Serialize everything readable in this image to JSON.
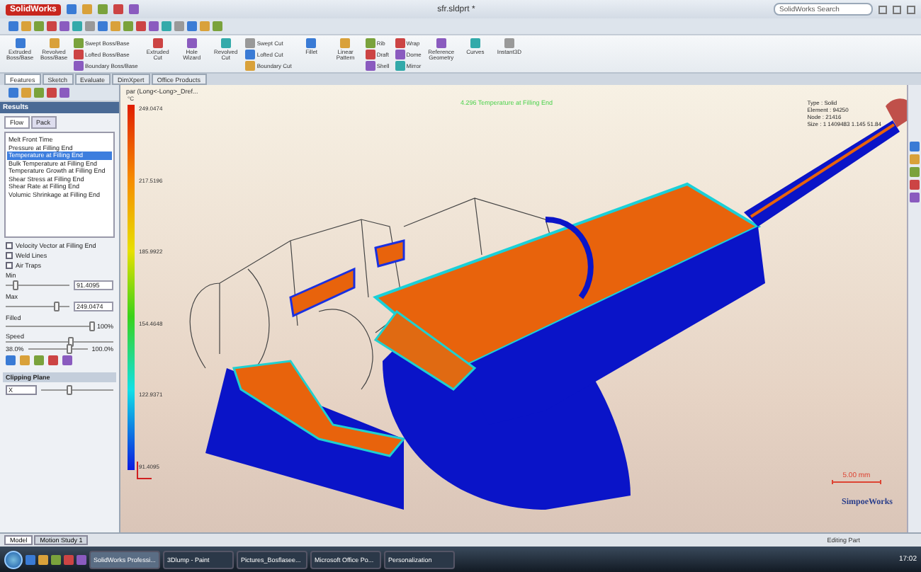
{
  "window": {
    "app": "SolidWorks",
    "title": "sfr.sldprt *",
    "search": {
      "placeholder": "SolidWorks Search"
    }
  },
  "ribbon": [
    {
      "kind": "large",
      "label": "Extruded Boss/Base"
    },
    {
      "kind": "large",
      "label": "Revolved Boss/Base"
    },
    {
      "kind": "stack",
      "items": [
        "Swept Boss/Base",
        "Lofted Boss/Base",
        "Boundary Boss/Base"
      ]
    },
    {
      "kind": "large",
      "label": "Extruded Cut"
    },
    {
      "kind": "large",
      "label": "Hole Wizard"
    },
    {
      "kind": "large",
      "label": "Revolved Cut"
    },
    {
      "kind": "stack",
      "items": [
        "Swept Cut",
        "Lofted Cut",
        "Boundary Cut"
      ]
    },
    {
      "kind": "large",
      "label": "Fillet"
    },
    {
      "kind": "large",
      "label": "Linear Pattern"
    },
    {
      "kind": "stack",
      "items": [
        "Rib",
        "Draft",
        "Shell"
      ]
    },
    {
      "kind": "stack",
      "items": [
        "Wrap",
        "Dome",
        "Mirror"
      ]
    },
    {
      "kind": "large",
      "label": "Reference Geometry"
    },
    {
      "kind": "large",
      "label": "Curves"
    },
    {
      "kind": "large",
      "label": "Instant3D"
    }
  ],
  "command_tabs": [
    {
      "label": "Features",
      "selected": true
    },
    {
      "label": "Sketch",
      "selected": false
    },
    {
      "label": "Evaluate",
      "selected": false
    },
    {
      "label": "DimXpert",
      "selected": false
    },
    {
      "label": "Office Products",
      "selected": false
    }
  ],
  "panel": {
    "title": "Results",
    "tabs": [
      {
        "label": "Flow",
        "selected": true
      },
      {
        "label": "Pack",
        "selected": false
      }
    ],
    "results": [
      {
        "label": "Melt Front Time",
        "selected": false
      },
      {
        "label": "Pressure at Filling End",
        "selected": false
      },
      {
        "label": "Temperature at Filling End",
        "selected": true
      },
      {
        "label": "Bulk Temperature at Filling End",
        "selected": false
      },
      {
        "label": "Temperature Growth at Filling End",
        "selected": false
      },
      {
        "label": "Shear Stress at Filling End",
        "selected": false
      },
      {
        "label": "Shear Rate at Filling End",
        "selected": false
      },
      {
        "label": "Volumic Shrinkage at Filling End",
        "selected": false
      }
    ],
    "options": [
      {
        "label": "Velocity Vector at Filling End",
        "checked": false
      },
      {
        "label": "Weld Lines",
        "checked": false
      },
      {
        "label": "Air Traps",
        "checked": false
      }
    ],
    "min": {
      "label": "Min",
      "level": 0.15,
      "value": "91.4095"
    },
    "max": {
      "label": "Max",
      "level": 0.8,
      "value": "249.0474"
    },
    "filled": {
      "label": "Filled",
      "level": 1.0,
      "reading": "100%"
    },
    "speed": {
      "label": "Speed",
      "level": 0.6
    },
    "range": {
      "start": "38.0%",
      "level": 0.7,
      "end": "100.0%"
    },
    "clipping": {
      "title": "Clipping Plane",
      "axis": "X",
      "level": 0.4
    }
  },
  "tree_root": "par (Long<-Long>_Dref...",
  "viewport": {
    "caption": "4.296 Temperature at Filling End",
    "legend": {
      "unit": "°C",
      "ticks": [
        "249.0474",
        "217.5196",
        "185.9922",
        "154.4648",
        "122.9371",
        "91.4095"
      ]
    },
    "info": [
      "Type : Solid",
      "Element : 94250",
      "Node : 21416",
      "Size : 1 1409483   1.145   51.84"
    ],
    "scale": "5.00 mm",
    "brand": "SimpoeWorks"
  },
  "bottom_tabs": [
    {
      "label": "Model",
      "selected": true
    },
    {
      "label": "Motion Study 1",
      "selected": false
    }
  ],
  "status": "Editing Part",
  "taskbar": {
    "tasks": [
      {
        "label": "SolidWorks Professi...",
        "selected": true
      },
      {
        "label": "3Dlump - Paint",
        "selected": false
      },
      {
        "label": "Pictures_Bosflasee...",
        "selected": false
      },
      {
        "label": "Microsoft Office Po...",
        "selected": false
      },
      {
        "label": "Personalization",
        "selected": false
      }
    ],
    "clock": "17:02"
  }
}
